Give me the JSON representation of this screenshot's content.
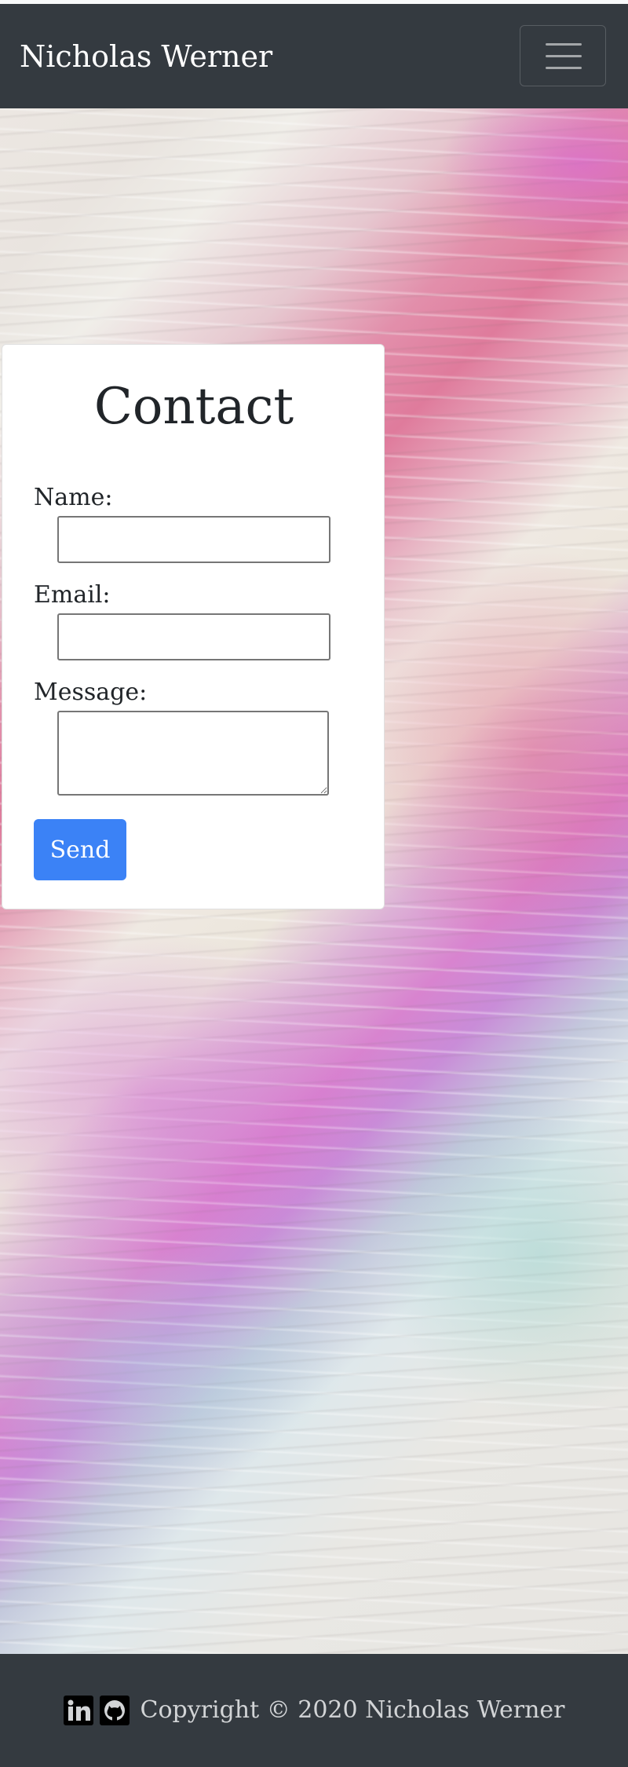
{
  "navbar": {
    "brand": "Nicholas Werner",
    "toggle_icon": "hamburger-menu-icon"
  },
  "contact": {
    "title": "Contact",
    "name_label": "Name:",
    "name_value": "",
    "email_label": "Email:",
    "email_value": "",
    "message_label": "Message:",
    "message_value": "",
    "send_label": "Send"
  },
  "footer": {
    "icons": [
      "linkedin-icon",
      "github-icon"
    ],
    "copyright": "Copyright © 2020 Nicholas Werner"
  },
  "colors": {
    "navbar_bg": "#343a40",
    "footer_bg": "#343a40",
    "button_bg": "#3b82f6",
    "card_bg": "#ffffff"
  }
}
